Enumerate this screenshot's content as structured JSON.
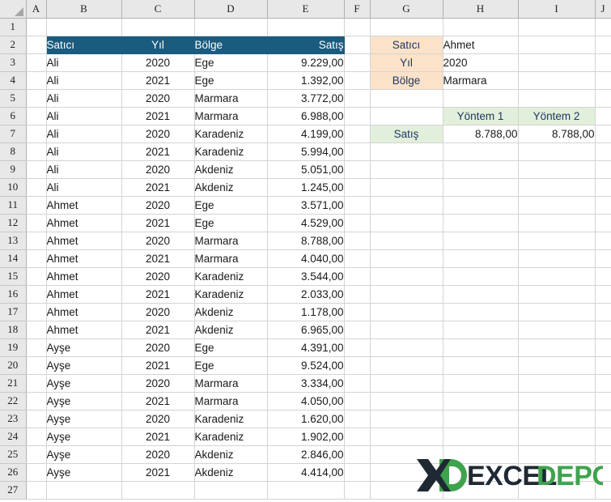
{
  "app": {
    "type": "spreadsheet",
    "column_headers": [
      "A",
      "B",
      "C",
      "D",
      "E",
      "F",
      "G",
      "H",
      "I",
      "J"
    ],
    "row_headers": [
      "1",
      "2",
      "3",
      "4",
      "5",
      "6",
      "7",
      "8",
      "9",
      "10",
      "11",
      "12",
      "13",
      "14",
      "15",
      "16",
      "17",
      "18",
      "19",
      "20",
      "21",
      "22",
      "23",
      "24",
      "25",
      "26",
      "27"
    ]
  },
  "colors": {
    "table_header_bg": "#1A5B80",
    "table_header_text": "#FFFFFF",
    "label_orange_bg": "#FBE2C8",
    "label_green_bg": "#E2EFDA",
    "label_text": "#1F3864",
    "gridline": "#D4D4D4",
    "header_strip_bg": "#E8E8E8",
    "logo_dark": "#1F2933",
    "logo_green": "#3FA34D"
  },
  "data_table": {
    "headers": [
      "Satıcı",
      "Yıl",
      "Bölge",
      "Satış"
    ],
    "rows": [
      {
        "satici": "Ali",
        "yil": "2020",
        "bolge": "Ege",
        "satis": "9.229,00"
      },
      {
        "satici": "Ali",
        "yil": "2021",
        "bolge": "Ege",
        "satis": "1.392,00"
      },
      {
        "satici": "Ali",
        "yil": "2020",
        "bolge": "Marmara",
        "satis": "3.772,00"
      },
      {
        "satici": "Ali",
        "yil": "2021",
        "bolge": "Marmara",
        "satis": "6.988,00"
      },
      {
        "satici": "Ali",
        "yil": "2020",
        "bolge": "Karadeniz",
        "satis": "4.199,00"
      },
      {
        "satici": "Ali",
        "yil": "2021",
        "bolge": "Karadeniz",
        "satis": "5.994,00"
      },
      {
        "satici": "Ali",
        "yil": "2020",
        "bolge": "Akdeniz",
        "satis": "5.051,00"
      },
      {
        "satici": "Ali",
        "yil": "2021",
        "bolge": "Akdeniz",
        "satis": "1.245,00"
      },
      {
        "satici": "Ahmet",
        "yil": "2020",
        "bolge": "Ege",
        "satis": "3.571,00"
      },
      {
        "satici": "Ahmet",
        "yil": "2021",
        "bolge": "Ege",
        "satis": "4.529,00"
      },
      {
        "satici": "Ahmet",
        "yil": "2020",
        "bolge": "Marmara",
        "satis": "8.788,00"
      },
      {
        "satici": "Ahmet",
        "yil": "2021",
        "bolge": "Marmara",
        "satis": "4.040,00"
      },
      {
        "satici": "Ahmet",
        "yil": "2020",
        "bolge": "Karadeniz",
        "satis": "3.544,00"
      },
      {
        "satici": "Ahmet",
        "yil": "2021",
        "bolge": "Karadeniz",
        "satis": "2.033,00"
      },
      {
        "satici": "Ahmet",
        "yil": "2020",
        "bolge": "Akdeniz",
        "satis": "1.178,00"
      },
      {
        "satici": "Ahmet",
        "yil": "2021",
        "bolge": "Akdeniz",
        "satis": "6.965,00"
      },
      {
        "satici": "Ayşe",
        "yil": "2020",
        "bolge": "Ege",
        "satis": "4.391,00"
      },
      {
        "satici": "Ayşe",
        "yil": "2021",
        "bolge": "Ege",
        "satis": "9.524,00"
      },
      {
        "satici": "Ayşe",
        "yil": "2020",
        "bolge": "Marmara",
        "satis": "3.334,00"
      },
      {
        "satici": "Ayşe",
        "yil": "2021",
        "bolge": "Marmara",
        "satis": "4.050,00"
      },
      {
        "satici": "Ayşe",
        "yil": "2020",
        "bolge": "Karadeniz",
        "satis": "1.620,00"
      },
      {
        "satici": "Ayşe",
        "yil": "2021",
        "bolge": "Karadeniz",
        "satis": "1.902,00"
      },
      {
        "satici": "Ayşe",
        "yil": "2020",
        "bolge": "Akdeniz",
        "satis": "2.846,00"
      },
      {
        "satici": "Ayşe",
        "yil": "2021",
        "bolge": "Akdeniz",
        "satis": "4.414,00"
      }
    ]
  },
  "criteria_panel": {
    "fields": [
      {
        "label": "Satıcı",
        "value": "Ahmet"
      },
      {
        "label": "Yıl",
        "value": "2020"
      },
      {
        "label": "Bölge",
        "value": "Marmara"
      }
    ]
  },
  "result_panel": {
    "method_headers": [
      "Yöntem 1",
      "Yöntem 2"
    ],
    "row_label": "Satış",
    "values": [
      "8.788,00",
      "8.788,00"
    ]
  },
  "logo": {
    "text_dark": "EXCEL",
    "text_green": "DEPO",
    "mark": "x-d-monogram"
  }
}
